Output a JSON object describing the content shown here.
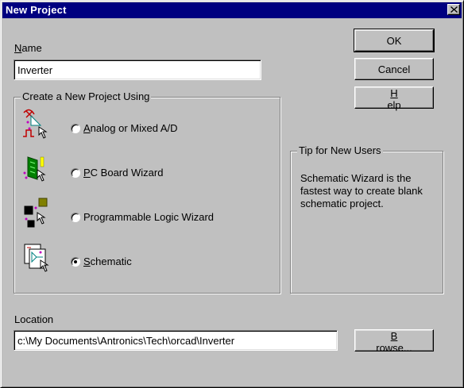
{
  "window": {
    "title": "New Project",
    "close_icon": "close-icon"
  },
  "name": {
    "label_first": "N",
    "label_rest": "ame",
    "value": "Inverter"
  },
  "buttons": {
    "ok": "OK",
    "cancel": "Cancel",
    "help_first": "H",
    "help_rest": "elp",
    "browse_first": "B",
    "browse_rest": "rowse..."
  },
  "create_group": {
    "legend": "Create a New Project Using",
    "options": [
      {
        "label_first": "A",
        "label_rest": "nalog or Mixed A/D",
        "selected": false,
        "icon": "analog-icon"
      },
      {
        "label_first": "P",
        "label_rest": "C Board Wizard",
        "selected": false,
        "icon": "pcb-wizard-icon"
      },
      {
        "label_first": "",
        "label_rest": "Programmable Logic Wizard",
        "selected": false,
        "icon": "pld-wizard-icon"
      },
      {
        "label_first": "S",
        "label_rest": "chematic",
        "selected": true,
        "icon": "schematic-icon"
      }
    ]
  },
  "tip_group": {
    "legend": "Tip for New Users",
    "text": "Schematic Wizard is the fastest way to create blank schematic project."
  },
  "location": {
    "label": "Location",
    "value": "c:\\My Documents\\Antronics\\Tech\\orcad\\Inverter"
  },
  "colors": {
    "titlebar": "#000080",
    "face": "#c0c0c0"
  }
}
